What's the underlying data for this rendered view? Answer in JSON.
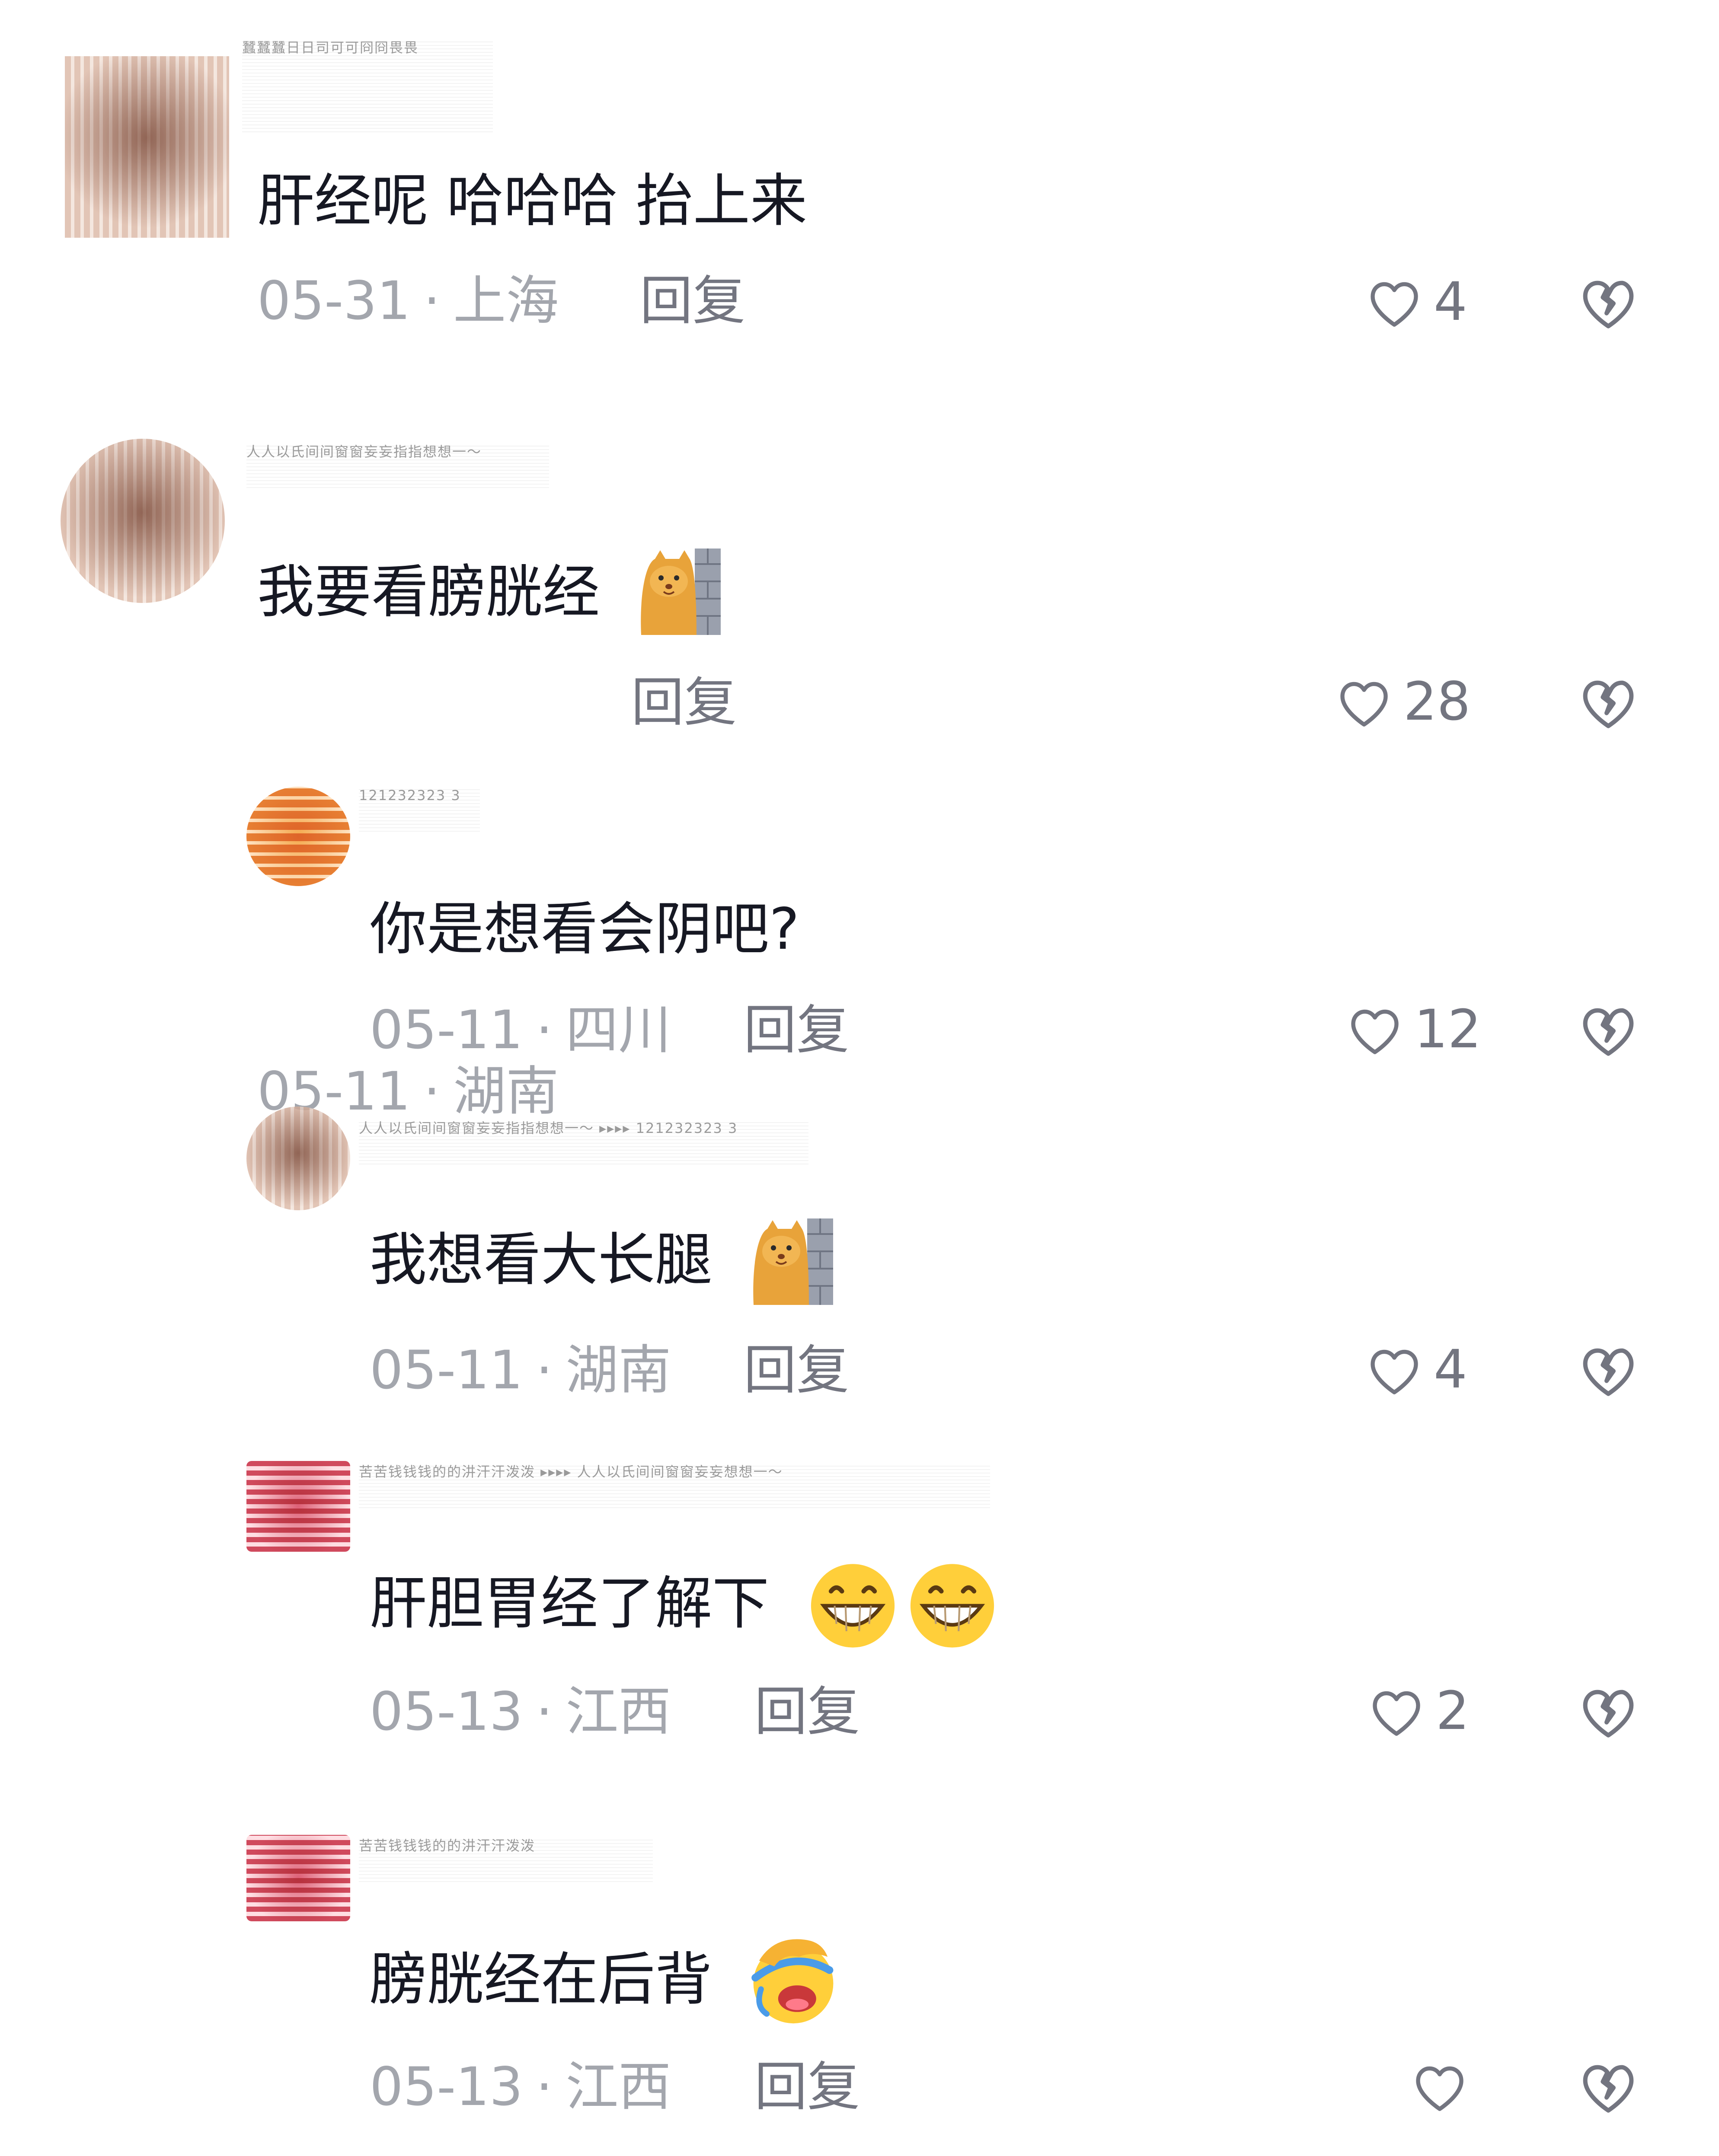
{
  "comments": [
    {
      "nickname": "蠶蠶蠶日日司可可冏冏畏畏",
      "text": "肝经呢 哈哈哈 抬上来",
      "date": "05-31",
      "location": "上海",
      "reply_label": "回复",
      "likes": "4",
      "emojis": []
    },
    {
      "nickname": "人人以氏间间窗窗妄妄指指想想一～",
      "text": "我要看膀胱经",
      "date": "05-11",
      "location": "湖南",
      "reply_label": "回复",
      "likes": "28",
      "emojis": [
        "cat-wall-emoji"
      ]
    },
    {
      "nickname": "121232323 3",
      "text": "你是想看会阴吧?",
      "date": "05-11",
      "location": "四川",
      "reply_label": "回复",
      "likes": "12",
      "emojis": []
    },
    {
      "nickname": "人人以氏间间窗窗妄妄指指想想一～ ▸▸▸▸ 121232323 3",
      "text": "我想看大长腿",
      "date": "05-11",
      "location": "湖南",
      "reply_label": "回复",
      "likes": "4",
      "emojis": [
        "cat-wall-emoji"
      ]
    },
    {
      "nickname": "苦苦钱钱钱的的汫汗汗泼泼 ▸▸▸▸ 人人以氏间间窗窗妄妄想想一～",
      "text": "肝胆胃经了解下",
      "date": "05-13",
      "location": "江西",
      "reply_label": "回复",
      "likes": "2",
      "emojis": [
        "grin-emoji",
        "grin-emoji"
      ]
    },
    {
      "nickname": "苦苦钱钱钱的的汫汗汗泼泼",
      "text": "膀胱经在后背",
      "date": "05-13",
      "location": "江西",
      "reply_label": "回复",
      "likes": "",
      "emojis": [
        "facepalm-cry-emoji"
      ]
    }
  ],
  "icons": {
    "like": "heart-outline-icon",
    "dislike": "broken-heart-icon"
  },
  "colors": {
    "text": "#161823",
    "meta": "#a3a6ad",
    "action": "#737580"
  }
}
